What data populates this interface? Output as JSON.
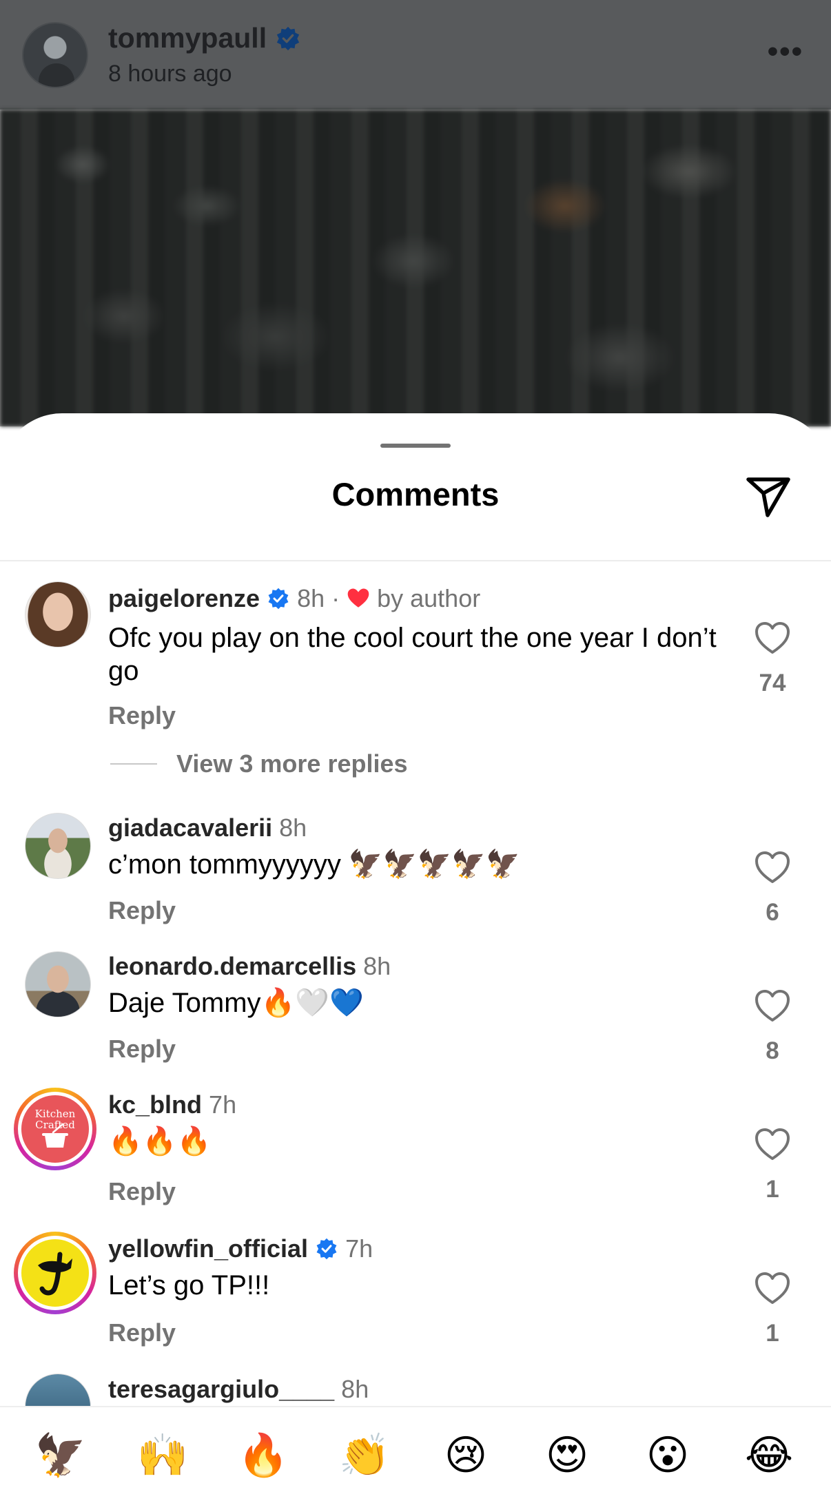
{
  "post": {
    "username": "tommypaull",
    "time": "8 hours ago",
    "more_label": "•••"
  },
  "sheet": {
    "title": "Comments"
  },
  "comments": [
    {
      "username": "paigelorenze",
      "verified": true,
      "time": "8h",
      "separator": "·",
      "author_liked": "by author",
      "text": "Ofc you play on the cool court the one year I don’t go",
      "reply": "Reply",
      "likes": "74"
    },
    {
      "username": "giadacavalerii",
      "verified": false,
      "time": "8h",
      "text": "c’mon tommyyyyyy 🦅🦅🦅🦅🦅",
      "reply": "Reply",
      "likes": "6"
    },
    {
      "username": "leonardo.demarcellis",
      "verified": false,
      "time": "8h",
      "text": "Daje Tommy🔥🤍💙",
      "reply": "Reply",
      "likes": "8"
    },
    {
      "username": "kc_blnd",
      "verified": false,
      "time": "7h",
      "text": "🔥🔥🔥",
      "reply": "Reply",
      "likes": "1",
      "avatar_text": "Kitchen Crafted"
    },
    {
      "username": "yellowfin_official",
      "verified": true,
      "time": "7h",
      "text": "Let’s go TP!!!",
      "reply": "Reply",
      "likes": "1"
    },
    {
      "username": "teresagargiulo____",
      "time": "8h"
    }
  ],
  "view_replies": "View 3 more replies",
  "emoji_bar": [
    "🦅",
    "🙌",
    "🔥",
    "👏",
    "😢",
    "😍",
    "😮",
    "😂"
  ],
  "colors": {
    "verified_blue": "#1877f2",
    "like_red": "#ff3040",
    "secondary_text": "#737373"
  }
}
